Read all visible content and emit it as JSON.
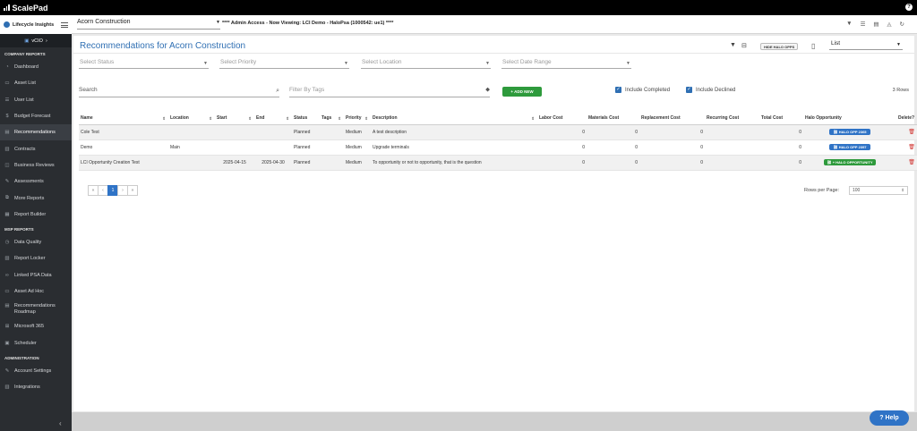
{
  "topbar": {
    "brand": "ScalePad"
  },
  "sidebar": {
    "brand": "Lifecycle Insights",
    "vcio_label": "vCIO",
    "sections": {
      "company": "COMPANY REPORTS",
      "msp": "MSP REPORTS",
      "admin": "ADMINISTRATION"
    },
    "company_items": [
      {
        "label": "Dashboard",
        "icon": "dashboard-icon"
      },
      {
        "label": "Asset List",
        "icon": "asset-list-icon"
      },
      {
        "label": "User List",
        "icon": "user-list-icon"
      },
      {
        "label": "Budget Forecast",
        "icon": "dollar-icon"
      },
      {
        "label": "Recommendations",
        "icon": "recommendations-icon"
      },
      {
        "label": "Contracts",
        "icon": "contracts-icon"
      },
      {
        "label": "Business Reviews",
        "icon": "business-reviews-icon"
      },
      {
        "label": "Assessments",
        "icon": "assessments-icon"
      },
      {
        "label": "More Reports",
        "icon": "more-reports-icon"
      },
      {
        "label": "Report Builder",
        "icon": "report-builder-icon"
      }
    ],
    "msp_items": [
      {
        "label": "Data Quality",
        "icon": "data-quality-icon"
      },
      {
        "label": "Report Locker",
        "icon": "report-locker-icon"
      },
      {
        "label": "Linked PSA Data",
        "icon": "link-icon"
      },
      {
        "label": "Asset Ad Hoc",
        "icon": "asset-ad-hoc-icon"
      },
      {
        "label": "Recommendations Roadmap",
        "icon": "roadmap-icon"
      },
      {
        "label": "Microsoft 365",
        "icon": "microsoft-icon"
      },
      {
        "label": "Scheduler",
        "icon": "scheduler-icon"
      }
    ],
    "admin_items": [
      {
        "label": "Account Settings",
        "icon": "settings-icon"
      },
      {
        "label": "Integrations",
        "icon": "integrations-icon"
      }
    ]
  },
  "header": {
    "client": "Acorn Construction",
    "banner": "**** Admin Access - Now Viewing: LCI Demo - HaloPsa (1000542: ue1) ****"
  },
  "page": {
    "title": "Recommendations for Acorn Construction",
    "hide_halo": "HIDE HALO OPPS",
    "view_select": "List",
    "filters": {
      "status": "Select Status",
      "priority": "Select Priority",
      "location": "Select Location",
      "date_range": "Select Date Range"
    },
    "search_placeholder": "Search",
    "tags_placeholder": "Filter By Tags",
    "add_new": "ADD NEW",
    "include_completed": "Include Completed",
    "include_declined": "Include Declined",
    "rows_count": "3 Rows"
  },
  "table": {
    "columns": [
      "Name",
      "Location",
      "Start",
      "End",
      "Status",
      "Tags",
      "Priority",
      "Description",
      "Labor Cost",
      "Materials Cost",
      "Replacement Cost",
      "Recurring Cost",
      "Total Cost",
      "Halo Opportunity",
      "Delete?"
    ],
    "rows": [
      {
        "name": "Cole Test",
        "location": "",
        "start": "",
        "end": "",
        "status": "Planned",
        "tags": "",
        "priority": "Medium",
        "description": "A test description",
        "labor": "0",
        "materials": "0",
        "replacement": "0",
        "recurring": "",
        "total": "0",
        "halo": "HALO OPP 2365",
        "halo_type": "blue"
      },
      {
        "name": "Demo",
        "location": "Main",
        "start": "",
        "end": "",
        "status": "Planned",
        "tags": "",
        "priority": "Medium",
        "description": "Upgrade terminals",
        "labor": "0",
        "materials": "0",
        "replacement": "0",
        "recurring": "",
        "total": "0",
        "halo": "HALO OPP 2397",
        "halo_type": "blue"
      },
      {
        "name": "LCI Opportunity Creation Test",
        "location": "",
        "start": "2025-04-15",
        "end": "2025-04-30",
        "status": "Planned",
        "tags": "",
        "priority": "Medium",
        "description": "To opportunity or not to opportunity, that is the question",
        "labor": "0",
        "materials": "0",
        "replacement": "0",
        "recurring": "",
        "total": "0",
        "halo": "+ HALO OPPORTUNITY",
        "halo_type": "green"
      }
    ]
  },
  "pager": {
    "first": "«",
    "prev": "‹",
    "current": "1",
    "next": "›",
    "last": "»"
  },
  "rows_per_page": {
    "label": "Rows per Page:",
    "value": "100"
  },
  "help": "Help"
}
